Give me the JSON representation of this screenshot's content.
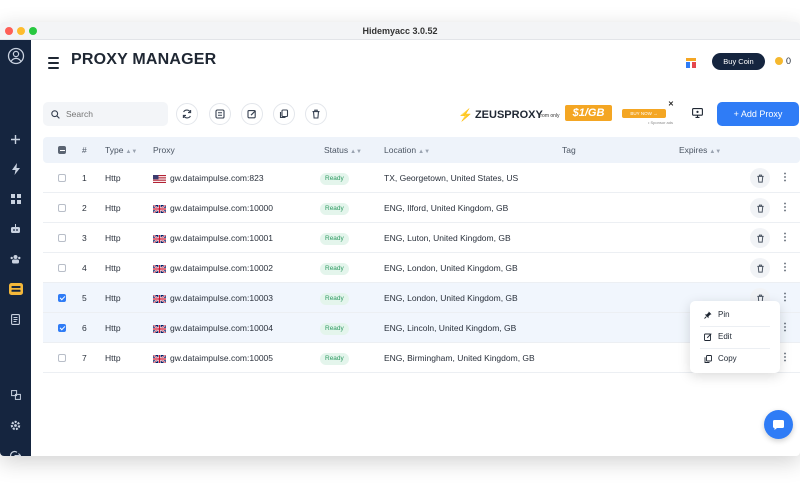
{
  "window": {
    "title": "Hidemyacc 3.0.52"
  },
  "header": {
    "title": "PROXY MANAGER",
    "buy_coin_label": "Buy Coin",
    "coin_count": "0"
  },
  "toolbar": {
    "search_placeholder": "Search",
    "add_proxy_label": "+ Add Proxy"
  },
  "ad": {
    "brand": "ZEUSPROXY",
    "from_text": "from only",
    "price": "$1/GB",
    "cta": "BUY NOW →",
    "sponsor": "• Sponsor ads",
    "close": "✕"
  },
  "table": {
    "columns": [
      "#",
      "Type",
      "Proxy",
      "Status",
      "Location",
      "Tag",
      "Expires"
    ],
    "rows": [
      {
        "num": "1",
        "type": "Http",
        "flag": "us",
        "proxy": "gw.dataimpulse.com:823",
        "status": "Ready",
        "location": "TX, Georgetown, United States, US",
        "tag": "",
        "expires": "",
        "checked": false
      },
      {
        "num": "2",
        "type": "Http",
        "flag": "gb",
        "proxy": "gw.dataimpulse.com:10000",
        "status": "Ready",
        "location": "ENG, Ilford, United Kingdom, GB",
        "tag": "",
        "expires": "",
        "checked": false
      },
      {
        "num": "3",
        "type": "Http",
        "flag": "gb",
        "proxy": "gw.dataimpulse.com:10001",
        "status": "Ready",
        "location": "ENG, Luton, United Kingdom, GB",
        "tag": "",
        "expires": "",
        "checked": false
      },
      {
        "num": "4",
        "type": "Http",
        "flag": "gb",
        "proxy": "gw.dataimpulse.com:10002",
        "status": "Ready",
        "location": "ENG, London, United Kingdom, GB",
        "tag": "",
        "expires": "",
        "checked": false
      },
      {
        "num": "5",
        "type": "Http",
        "flag": "gb",
        "proxy": "gw.dataimpulse.com:10003",
        "status": "Ready",
        "location": "ENG, London, United Kingdom, GB",
        "tag": "",
        "expires": "",
        "checked": true
      },
      {
        "num": "6",
        "type": "Http",
        "flag": "gb",
        "proxy": "gw.dataimpulse.com:10004",
        "status": "Ready",
        "location": "ENG, Lincoln, United Kingdom, GB",
        "tag": "",
        "expires": "",
        "checked": true
      },
      {
        "num": "7",
        "type": "Http",
        "flag": "gb",
        "proxy": "gw.dataimpulse.com:10005",
        "status": "Ready",
        "location": "ENG, Birmingham, United Kingdom, GB",
        "tag": "",
        "expires": "",
        "checked": false
      }
    ]
  },
  "context_menu": {
    "pin_label": "Pin",
    "edit_label": "Edit",
    "copy_label": "Copy"
  },
  "colors": {
    "sidebar": "#15253f",
    "accent": "#2f7cf6",
    "ready": "#2e9a62",
    "active_nav": "#f4b83a"
  },
  "sidebar": {
    "icons": [
      "avatar-icon",
      "plus-icon",
      "lightning-icon",
      "grid-icon",
      "robot-icon",
      "team-icon",
      "proxy-icon",
      "document-icon",
      "sync-icon",
      "settings-icon",
      "logout-icon"
    ],
    "active": "proxy-icon"
  }
}
